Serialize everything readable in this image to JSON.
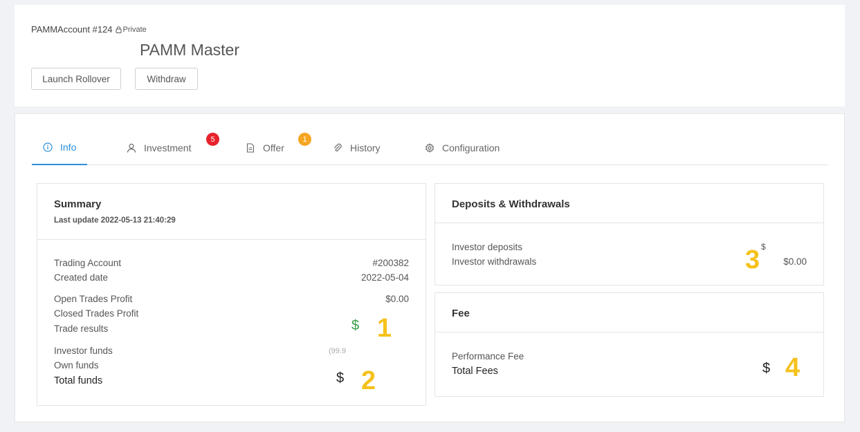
{
  "header": {
    "account_label": "PAMMAccount #124",
    "privacy": "Private",
    "title": "PAMM Master",
    "launch_rollover": "Launch Rollover",
    "withdraw": "Withdraw"
  },
  "tabs": [
    {
      "label": "Info",
      "icon": "info-icon",
      "active": true
    },
    {
      "label": "Investment",
      "icon": "user-icon",
      "badge": "5",
      "badge_color": "#e8222c"
    },
    {
      "label": "Offer",
      "icon": "document-icon",
      "badge": "1",
      "badge_color": "#f5a623"
    },
    {
      "label": "History",
      "icon": "paperclip-icon"
    },
    {
      "label": "Configuration",
      "icon": "gear-icon"
    }
  ],
  "summary": {
    "title": "Summary",
    "last_update": "Last update 2022-05-13 21:40:29",
    "trading_account_label": "Trading Account",
    "trading_account_value": "#200382",
    "created_date_label": "Created date",
    "created_date_value": "2022-05-04",
    "open_trades_label": "Open Trades Profit",
    "open_trades_value": "$0.00",
    "closed_trades_label": "Closed Trades Profit",
    "trade_results_label": "Trade results",
    "trade_results_symbol": "$",
    "investor_funds_label": "Investor funds",
    "investor_funds_partial": "(99.9",
    "own_funds_label": "Own funds",
    "total_funds_label": "Total funds",
    "total_funds_symbol": "$",
    "marker_1": "1",
    "marker_2": "2"
  },
  "deposits": {
    "title": "Deposits & Withdrawals",
    "investor_deposits_label": "Investor deposits",
    "investor_deposits_symbol": "$",
    "investor_withdrawals_label": "Investor withdrawals",
    "investor_withdrawals_value": "$0.00",
    "marker_3": "3"
  },
  "fee": {
    "title": "Fee",
    "performance_fee_label": "Performance Fee",
    "total_fees_label": "Total Fees",
    "total_fees_symbol": "$",
    "marker_4": "4"
  },
  "colors": {
    "accent": "#2a8ed8",
    "marker": "#f5c11b",
    "positive": "#3a9d4a"
  }
}
